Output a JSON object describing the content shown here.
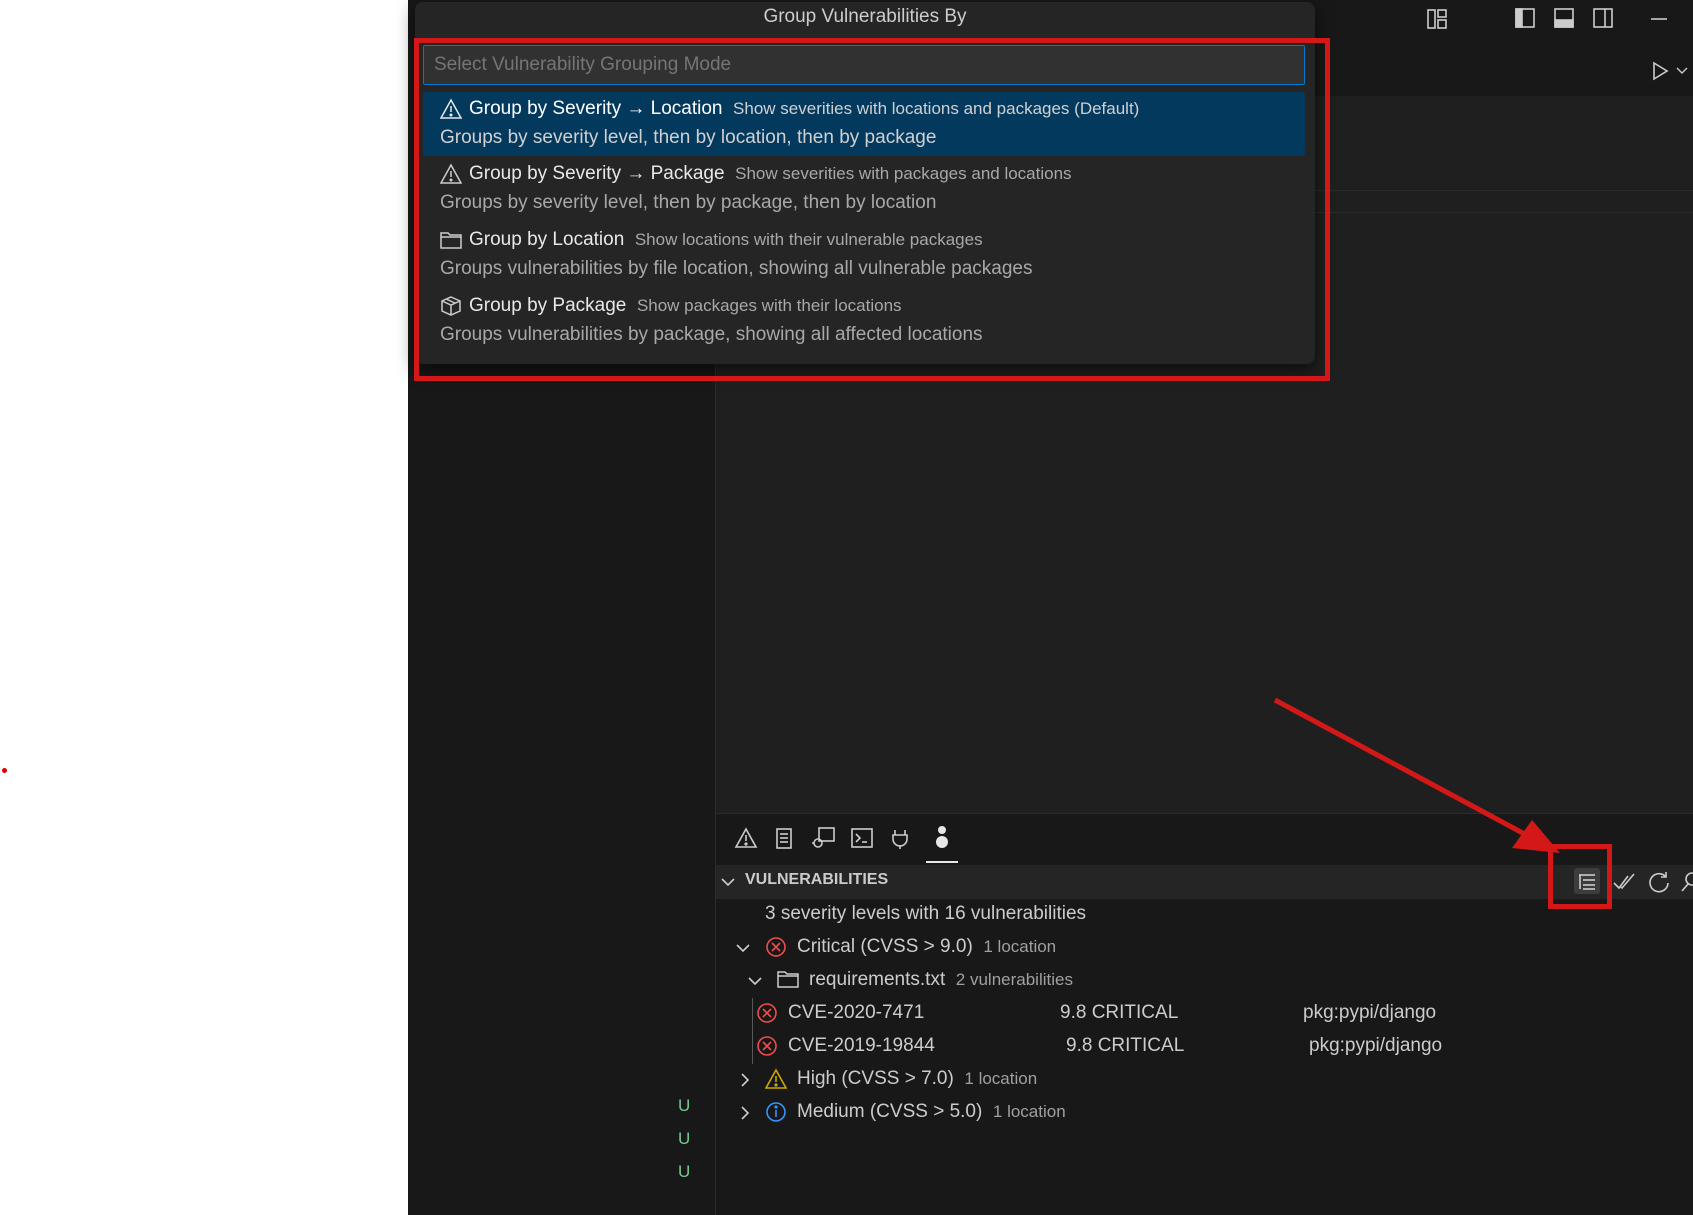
{
  "quick_pick": {
    "title": "Group Vulnerabilities By",
    "placeholder": "Select Vulnerability Grouping Mode",
    "items": [
      {
        "icon": "warning-icon",
        "label": "Group by Severity → Location",
        "description": "Show severities with locations and packages (Default)",
        "detail": "Groups by severity level, then by location, then by package",
        "selected": true
      },
      {
        "icon": "warning-icon",
        "label": "Group by Severity → Package",
        "description": "Show severities with packages and locations",
        "detail": "Groups by severity level, then by package, then by location",
        "selected": false
      },
      {
        "icon": "folder-icon",
        "label": "Group by Location",
        "description": "Show locations with their vulnerable packages",
        "detail": "Groups vulnerabilities by file location, showing all vulnerable packages",
        "selected": false
      },
      {
        "icon": "package-icon",
        "label": "Group by Package",
        "description": "Show packages with their locations",
        "detail": "Groups vulnerabilities by package, showing all affected locations",
        "selected": false
      }
    ]
  },
  "titlebar_icons": [
    "customize-layout-icon",
    "toggle-primary-sidebar-icon",
    "toggle-panel-icon",
    "toggle-secondary-sidebar-icon",
    "minimize-icon"
  ],
  "editor_actions": [
    "run-icon",
    "chevron-down-icon"
  ],
  "panel": {
    "tabs": [
      "problems-icon",
      "output-icon",
      "debug-console-icon",
      "terminal-icon",
      "ports-icon",
      "vulnerabilities-icon"
    ],
    "section_title": "VULNERABILITIES",
    "actions": [
      "group-by-icon",
      "check-all-icon",
      "refresh-icon",
      "search-icon"
    ],
    "summary": "3 severity levels with 16 vulnerabilities",
    "tree": {
      "critical": {
        "label": "Critical (CVSS > 9.0)",
        "count": "1 location"
      },
      "file": {
        "label": "requirements.txt",
        "count": "2 vulnerabilities"
      },
      "vulns": [
        {
          "id": "CVE-2020-7471",
          "score": "9.8 CRITICAL",
          "package": "pkg:pypi/django"
        },
        {
          "id": "CVE-2019-19844",
          "score": "9.8 CRITICAL",
          "package": "pkg:pypi/django"
        }
      ],
      "high": {
        "label": "High (CVSS > 7.0)",
        "count": "1 location"
      },
      "medium": {
        "label": "Medium (CVSS > 5.0)",
        "count": "1 location"
      }
    }
  },
  "sidebar": {
    "git_status": [
      "U",
      "U",
      "U"
    ]
  },
  "colors": {
    "accent": "#0078d4",
    "selection": "#04395e",
    "annotation": "#d41818",
    "critical": "#f14c4c",
    "warning": "#cca700",
    "info": "#3794ff",
    "git_untracked": "#73c991"
  }
}
